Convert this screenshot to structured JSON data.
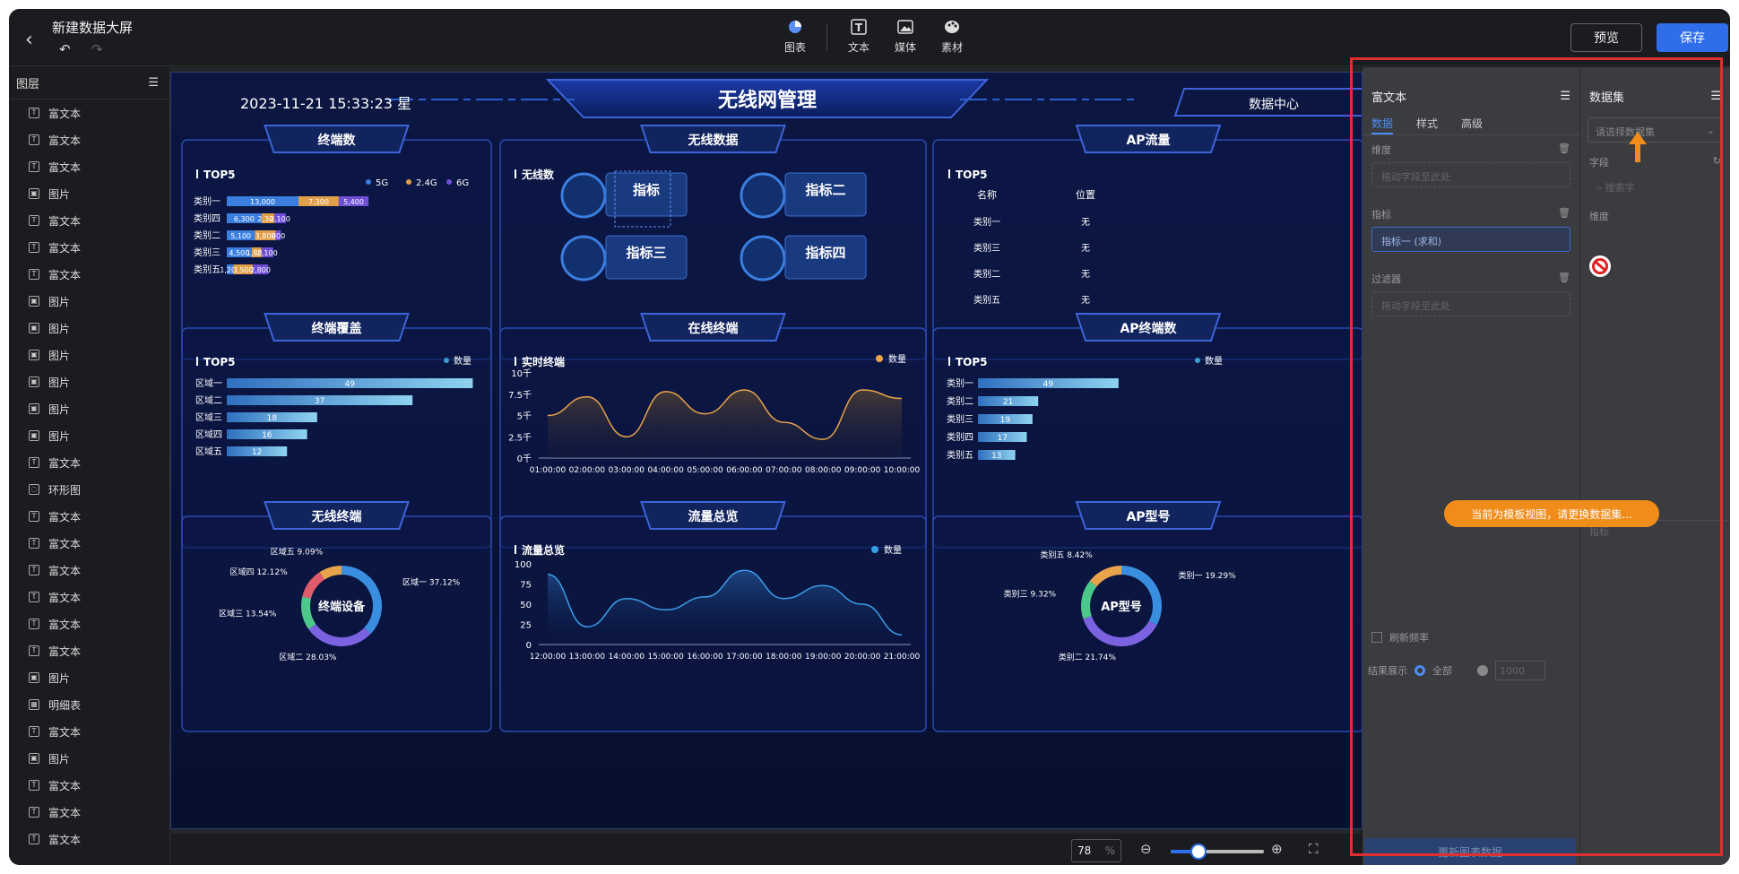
{
  "app": {
    "title": "新建数据大屏",
    "preview_label": "预览",
    "save_label": "保存"
  },
  "toolbar": {
    "tools": [
      {
        "label": "图表",
        "icon": "pie-chart-icon"
      },
      {
        "label": "文本",
        "icon": "text-icon"
      },
      {
        "label": "媒体",
        "icon": "image-icon"
      },
      {
        "label": "素材",
        "icon": "palette-icon"
      }
    ]
  },
  "layers": {
    "title": "图层",
    "items": [
      {
        "label": "富文本",
        "type": "text"
      },
      {
        "label": "富文本",
        "type": "text"
      },
      {
        "label": "富文本",
        "type": "text"
      },
      {
        "label": "图片",
        "type": "image"
      },
      {
        "label": "富文本",
        "type": "text"
      },
      {
        "label": "富文本",
        "type": "text"
      },
      {
        "label": "富文本",
        "type": "text"
      },
      {
        "label": "图片",
        "type": "image"
      },
      {
        "label": "图片",
        "type": "image"
      },
      {
        "label": "图片",
        "type": "image"
      },
      {
        "label": "图片",
        "type": "image"
      },
      {
        "label": "图片",
        "type": "image"
      },
      {
        "label": "图片",
        "type": "image"
      },
      {
        "label": "富文本",
        "type": "text"
      },
      {
        "label": "环形图",
        "type": "ring"
      },
      {
        "label": "富文本",
        "type": "text"
      },
      {
        "label": "富文本",
        "type": "text"
      },
      {
        "label": "富文本",
        "type": "text"
      },
      {
        "label": "富文本",
        "type": "text"
      },
      {
        "label": "富文本",
        "type": "text"
      },
      {
        "label": "富文本",
        "type": "text"
      },
      {
        "label": "图片",
        "type": "image"
      },
      {
        "label": "明细表",
        "type": "table"
      },
      {
        "label": "富文本",
        "type": "text"
      },
      {
        "label": "图片",
        "type": "image"
      },
      {
        "label": "富文本",
        "type": "text"
      },
      {
        "label": "富文本",
        "type": "text"
      },
      {
        "label": "富文本",
        "type": "text"
      }
    ]
  },
  "dashboard": {
    "datetime": "2023-11-21 15:33:23 星",
    "title": "无线网管理",
    "data_center": "数据中心",
    "panels": {
      "terminals": "终端数",
      "wireless_data": "无线数据",
      "ap_traffic": "AP流量",
      "coverage": "终端覆盖",
      "online": "在线终端",
      "ap_terminals": "AP终端数",
      "wireless_terminals": "无线终端",
      "traffic_overview": "流量总览",
      "ap_model": "AP型号"
    },
    "top5": "TOP5",
    "wireless_count": "无线数",
    "realtime": "实时终端",
    "traffic_overview_label": "流量总览",
    "indicators": [
      "指标",
      "指标二",
      "指标三",
      "指标四"
    ],
    "indicator_overflow": "|指标",
    "ap_table": {
      "headers": [
        "名称",
        "位置"
      ],
      "rows": [
        [
          "类别一",
          "无"
        ],
        [
          "类别三",
          "无"
        ],
        [
          "类别二",
          "无"
        ],
        [
          "类别五",
          "无"
        ]
      ]
    },
    "donut1_center": "终端设备",
    "donut2_center": "AP型号"
  },
  "chart_data": [
    {
      "type": "bar",
      "id": "terminal-count",
      "series": [
        {
          "name": "5G",
          "values": [
            13000,
            6300,
            5100,
            4500,
            1200
          ]
        },
        {
          "name": "2.4G",
          "values": [
            7300,
            2300,
            3800,
            1800,
            3500
          ]
        },
        {
          "name": "6G",
          "values": [
            5400,
            2100,
            900,
            2100,
            2800
          ]
        }
      ],
      "categories": [
        "类别一",
        "类别四",
        "类别二",
        "类别三",
        "类别五"
      ],
      "labels": [
        [
          "13,000",
          "7,300",
          "5,400"
        ],
        [
          "6,300",
          "2,300",
          "2,100"
        ],
        [
          "5,100",
          "3,800",
          "900"
        ],
        [
          "4,500",
          "1,800",
          "2,100"
        ],
        [
          "1,200",
          "3,500",
          "2,800"
        ]
      ]
    },
    {
      "type": "bar",
      "id": "coverage",
      "series": [
        {
          "name": "数量",
          "values": [
            49,
            37,
            18,
            16,
            12
          ]
        }
      ],
      "categories": [
        "区域一",
        "区域二",
        "区域三",
        "区域四",
        "区域五"
      ]
    },
    {
      "type": "area",
      "id": "online",
      "series": [
        {
          "name": "数量",
          "values": [
            5000,
            7200,
            2500,
            7800,
            5200,
            8000,
            4200,
            2200,
            8000,
            7000
          ]
        }
      ],
      "categories": [
        "01:00:00",
        "02:00:00",
        "03:00:00",
        "04:00:00",
        "05:00:00",
        "06:00:00",
        "07:00:00",
        "08:00:00",
        "09:00:00",
        "10:00:00"
      ],
      "yticks": [
        "0千",
        "2.5千",
        "5千",
        "7.5千",
        "10千"
      ]
    },
    {
      "type": "bar",
      "id": "ap-terminals",
      "series": [
        {
          "name": "数量",
          "values": [
            49,
            21,
            19,
            17,
            13
          ]
        }
      ],
      "categories": [
        "类别一",
        "类别二",
        "类别三",
        "类别四",
        "类别五"
      ]
    },
    {
      "type": "area",
      "id": "traffic",
      "series": [
        {
          "name": "数量",
          "values": [
            87,
            22,
            57,
            43,
            59,
            92,
            57,
            73,
            50,
            12
          ]
        }
      ],
      "categories": [
        "12:00:00",
        "13:00:00",
        "14:00:00",
        "15:00:00",
        "16:00:00",
        "17:00:00",
        "18:00:00",
        "19:00:00",
        "20:00:00",
        "21:00:00"
      ],
      "yticks": [
        "0",
        "25",
        "50",
        "75",
        "100"
      ]
    },
    {
      "type": "pie",
      "id": "wireless-terminals",
      "slices": [
        {
          "label": "区域一",
          "pct": 37.12
        },
        {
          "label": "区域二",
          "pct": 28.03
        },
        {
          "label": "区域三",
          "pct": 13.54
        },
        {
          "label": "区域四",
          "pct": 12.12
        },
        {
          "label": "区域五",
          "pct": 9.09
        }
      ]
    },
    {
      "type": "pie",
      "id": "ap-model",
      "slices": [
        {
          "label": "类别一",
          "pct": 19.29
        },
        {
          "label": "类别二",
          "pct": 21.74
        },
        {
          "label": "类别三",
          "pct": 9.32
        },
        {
          "label": "类别五",
          "pct": 8.42
        }
      ]
    }
  ],
  "rich_text_panel": {
    "title": "富文本",
    "tabs": [
      "数据",
      "样式",
      "高级"
    ],
    "dimension_label": "维度",
    "dimension_placeholder": "拖动字段至此处",
    "metric_label": "指标",
    "metric_value": "指标一 (求和)",
    "filter_label": "过滤器",
    "filter_placeholder": "拖动字段至此处",
    "refresh_label": "刷新频率",
    "result_label": "结果展示",
    "result_all": "全部",
    "result_limit": "1000",
    "update_button": "更新图表数据"
  },
  "dataset_panel": {
    "title": "数据集",
    "select_placeholder": "请选择数据集",
    "field_label": "字段",
    "search_placeholder": "搜索字",
    "dimension_label": "维度",
    "metric_label": "指标"
  },
  "toast": "当前为模板视图，请更换数据集...",
  "zoom": {
    "value": "78",
    "unit": "%"
  },
  "colors": {
    "accent": "#2f6eea",
    "toast": "#f08c1a",
    "highlight": "#e02f2f"
  }
}
